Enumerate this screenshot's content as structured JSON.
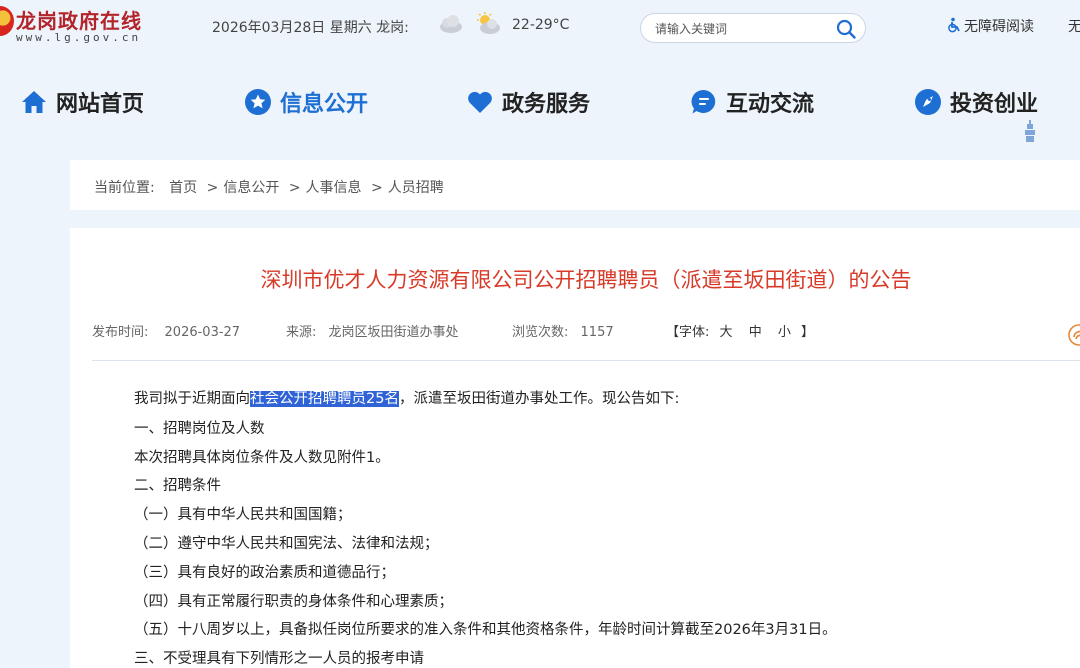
{
  "header": {
    "logo_title": "龙岗政府在线",
    "logo_url": "www.lg.gov.cn",
    "date": "2026年03月28日 星期六 龙岗:",
    "temperature": "22-29°C",
    "weather_icons": [
      "cloud-icon",
      "sun-cloud-icon"
    ],
    "search_placeholder": "请输入关键词",
    "accessibility_label": "无障碍阅读",
    "extra_label": "无"
  },
  "nav": {
    "items": [
      {
        "label": "网站首页",
        "icon": "home-icon"
      },
      {
        "label": "信息公开",
        "icon": "star-icon"
      },
      {
        "label": "政务服务",
        "icon": "heart-icon"
      },
      {
        "label": "互动交流",
        "icon": "chat-icon"
      },
      {
        "label": "投资创业",
        "icon": "rocket-icon"
      }
    ],
    "active_index": 1
  },
  "breadcrumb": {
    "prefix": "当前位置:",
    "items": [
      "首页",
      "信息公开",
      "人事信息",
      "人员招聘"
    ],
    "separator": ">"
  },
  "article": {
    "title": "深圳市优才人力资源有限公司公开招聘聘员（派遣至坂田街道）的公告",
    "meta": {
      "publish_label": "发布时间:",
      "publish_date": "2026-03-27",
      "source_label": "来源:",
      "source": "龙岗区坂田街道办事处",
      "views_label": "浏览次数:",
      "views": "1157"
    },
    "font_size": {
      "open": "【字体:",
      "large": "大",
      "medium": "中",
      "small": "小",
      "close": "】"
    },
    "paragraph1": {
      "before": "我司拟于近期面向",
      "highlight": "社会公开招聘聘员25名",
      "after": "，派遣至坂田街道办事处工作。现公告如下:"
    },
    "lines": [
      "一、招聘岗位及人数",
      "本次招聘具体岗位条件及人数见附件1。",
      "二、招聘条件",
      "（一）具有中华人民共和国国籍；",
      "（二）遵守中华人民共和国宪法、法律和法规；",
      "（三）具有良好的政治素质和道德品行；",
      "（四）具有正常履行职责的身体条件和心理素质；",
      "（五）十八周岁以上，具备拟任岗位所要求的准入条件和其他资格条件，年龄时间计算截至2026年3月31日。",
      "三、不受理具有下列情形之一人员的报考申请"
    ]
  },
  "colors": {
    "accent": "#1e6fd4",
    "title_red": "#d83a28",
    "highlight": "#2f63d6",
    "background": "#eef4fb"
  }
}
